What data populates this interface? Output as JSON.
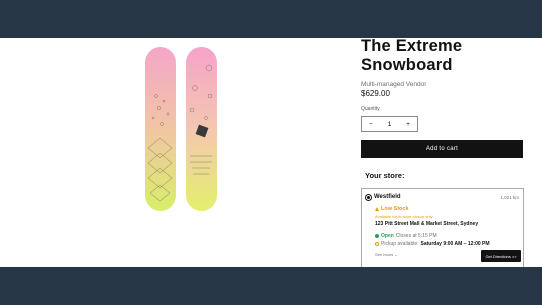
{
  "product": {
    "title": "The Extreme Snowboard",
    "vendor": "Multi-managed Vendor",
    "price": "$629.00",
    "image_alt": "snowboard-image"
  },
  "quantity": {
    "label": "Quantity",
    "minus": "−",
    "value": "1",
    "plus": "+"
  },
  "add_to_cart": "Add to cart",
  "store": {
    "heading": "Your store:",
    "name": "Westfield",
    "distance": "1,021 km",
    "stock_status": "Low Stock",
    "stock_note": "Available for in-store pickup only",
    "address": "123 Pitt Street Mall & Market Street, Sydney",
    "open_label": "Open",
    "closes": "Closes at 5:15 PM",
    "pickup_prefix": "Pickup available:",
    "pickup_time": "Saturday 9:00 AM – 12:00 PM",
    "see_hours": "See hours",
    "see_hours_chevron": "⌄",
    "directions": "Get Directions >>"
  },
  "colors": {
    "band": "#263646",
    "button": "#121212",
    "low_stock": "#e0a100",
    "open": "#2e9e58"
  }
}
